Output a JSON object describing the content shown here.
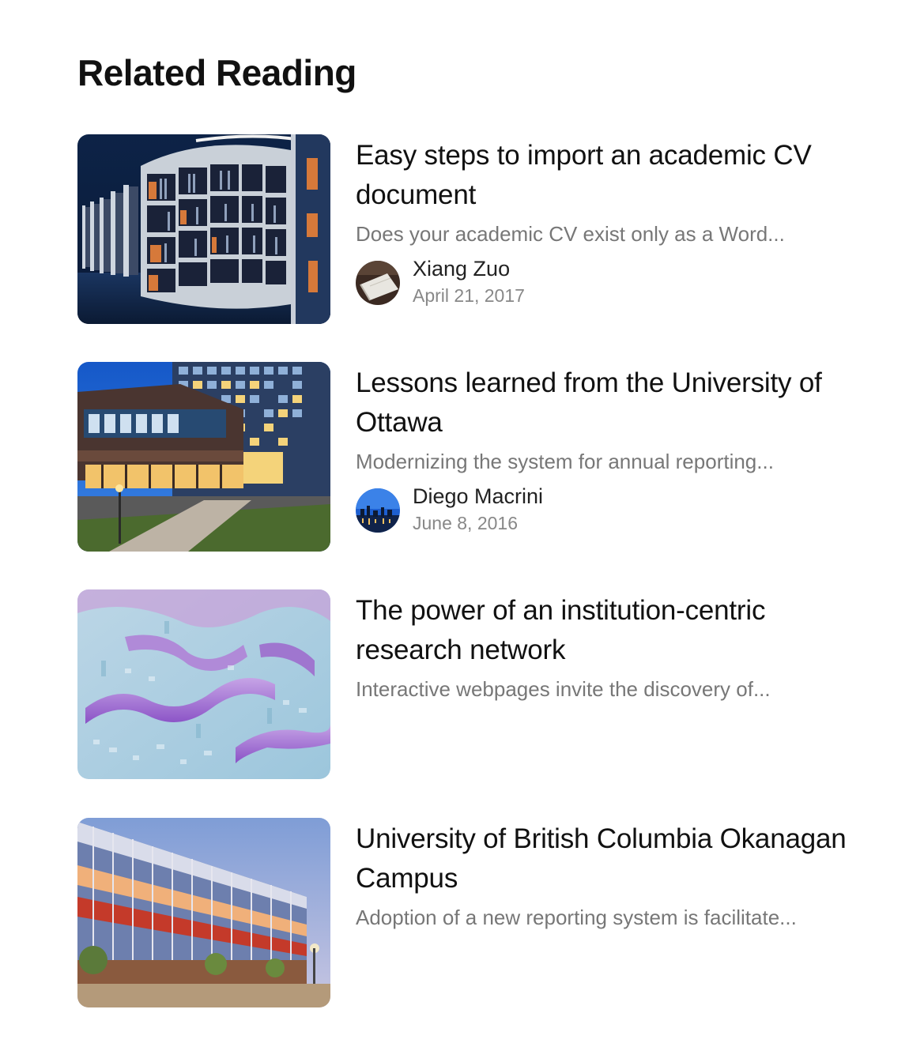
{
  "section": {
    "title": "Related Reading"
  },
  "articles": [
    {
      "title": "Easy steps to import an academic CV document",
      "excerpt": "Does your academic CV exist only as a Word...",
      "image": "library-bookshelves-photo",
      "author": {
        "name": "Xiang Zuo",
        "date": "April 21, 2017",
        "avatar": "notebook-photo-avatar"
      }
    },
    {
      "title": "Lessons learned from the University of Ottawa",
      "excerpt": "Modernizing the system for annual reporting...",
      "image": "university-building-night-photo",
      "author": {
        "name": "Diego Macrini",
        "date": "June 8, 2016",
        "avatar": "city-skyline-photo-avatar"
      }
    },
    {
      "title": "The power of an institution-centric research network",
      "excerpt": "Interactive webpages invite the discovery of...",
      "image": "abstract-3d-terrain-render"
    },
    {
      "title": "University of British Columbia Okanagan Campus",
      "excerpt": "Adoption of a new reporting system is facilitate...",
      "image": "glass-campus-building-dusk-photo"
    }
  ]
}
